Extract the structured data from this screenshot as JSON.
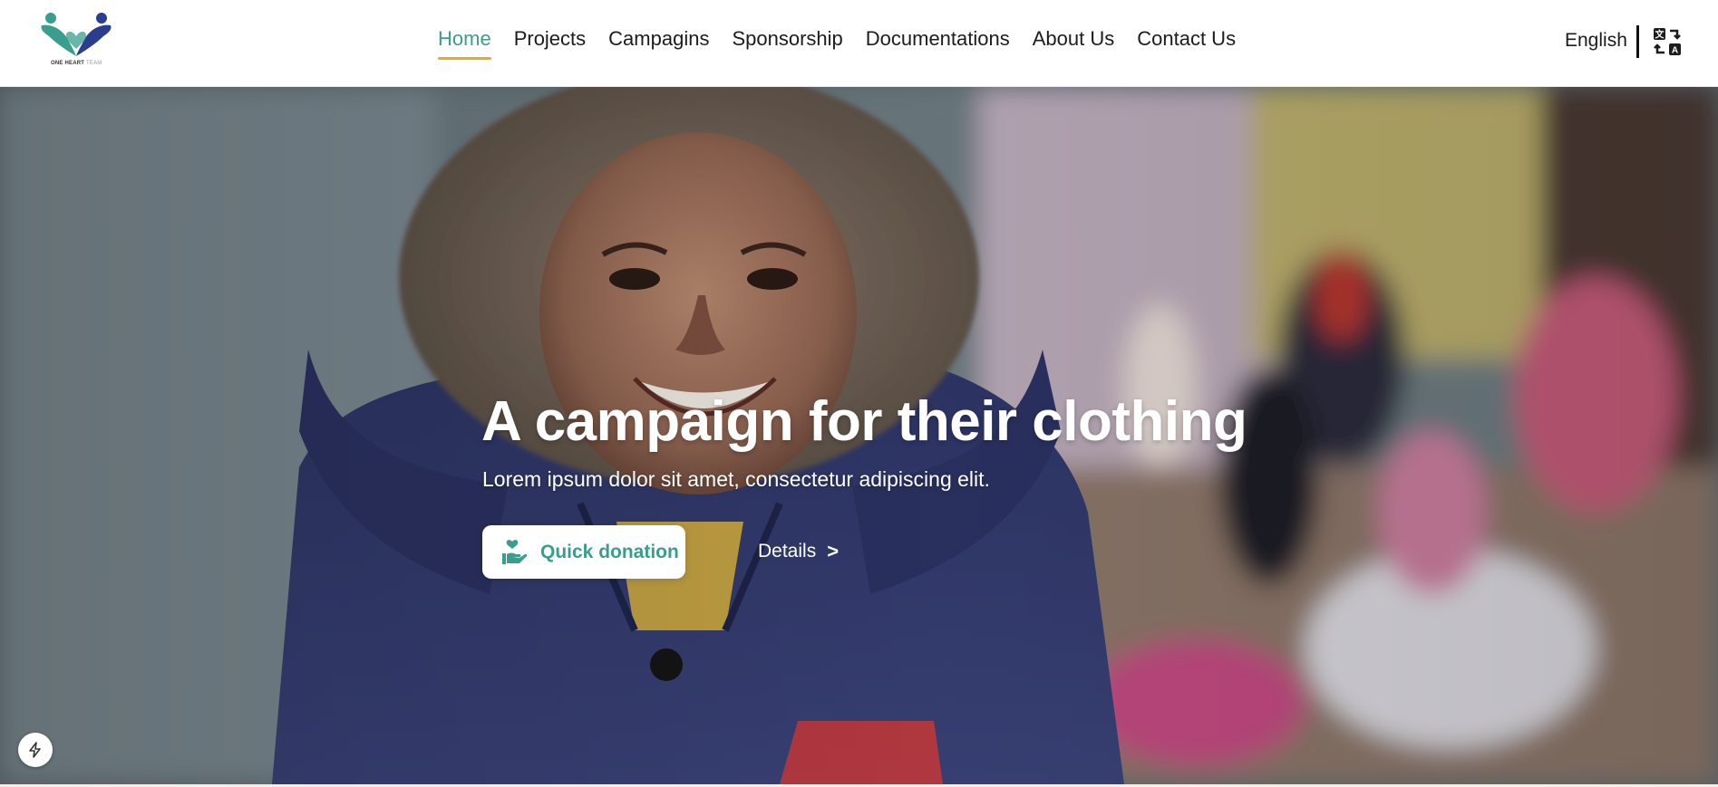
{
  "brand": {
    "logo_text": "ONE HEART",
    "logo_text_suffix": "TEAM",
    "colors": {
      "teal": "#3a9e8e",
      "navy": "#2b3d8f",
      "accent": "#f0a81c"
    }
  },
  "nav": {
    "items": [
      {
        "label": "Home",
        "active": true
      },
      {
        "label": "Projects"
      },
      {
        "label": "Campagins"
      },
      {
        "label": "Sponsorship"
      },
      {
        "label": "Documentations"
      },
      {
        "label": "About Us"
      },
      {
        "label": "Contact Us"
      }
    ]
  },
  "language": {
    "label": "English",
    "icon": "translate-icon"
  },
  "hero": {
    "title": "A campaign for their clothing",
    "subtitle": "Lorem ipsum dolor sit amet, consectetur adipiscing elit.",
    "donate_label": "Quick donation",
    "donate_icon": "hand-heart-icon",
    "details_label": "Details",
    "details_arrow": ">",
    "background": "photo of a smiling child in a navy hooded jacket with children in background"
  },
  "fab": {
    "icon": "lightning-icon"
  }
}
